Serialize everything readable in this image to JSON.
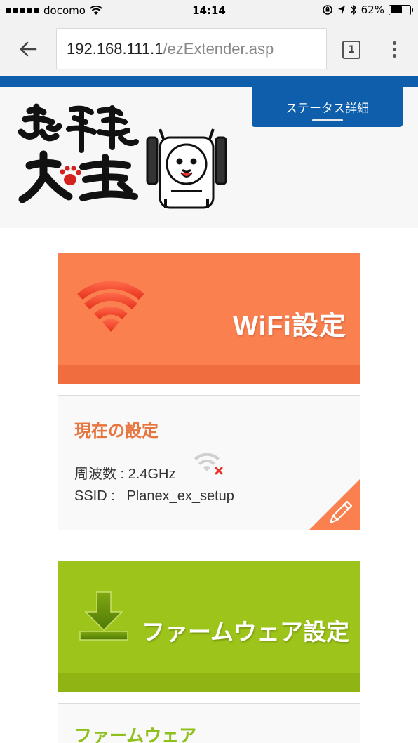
{
  "status_bar": {
    "carrier": "docomo",
    "time": "14:14",
    "battery_percent_text": "62%",
    "battery_level": 0.62
  },
  "browser": {
    "url_host": "192.168.111.1",
    "url_path": "/ezExtender.asp",
    "tab_count": "1"
  },
  "header": {
    "status_detail_label": "ステータス詳細"
  },
  "wifi_section": {
    "banner_title": "WiFi設定",
    "card_title": "現在の設定",
    "frequency_line": "周波数 : 2.4GHz",
    "ssid_line": "SSID :   Planex_ex_setup"
  },
  "firmware_section": {
    "banner_title": "ファームウェア設定",
    "card_title": "ファームウェア"
  },
  "colors": {
    "brand_blue": "#0e5eab",
    "wifi_orange": "#fb8050",
    "firmware_green": "#9dc41a"
  }
}
